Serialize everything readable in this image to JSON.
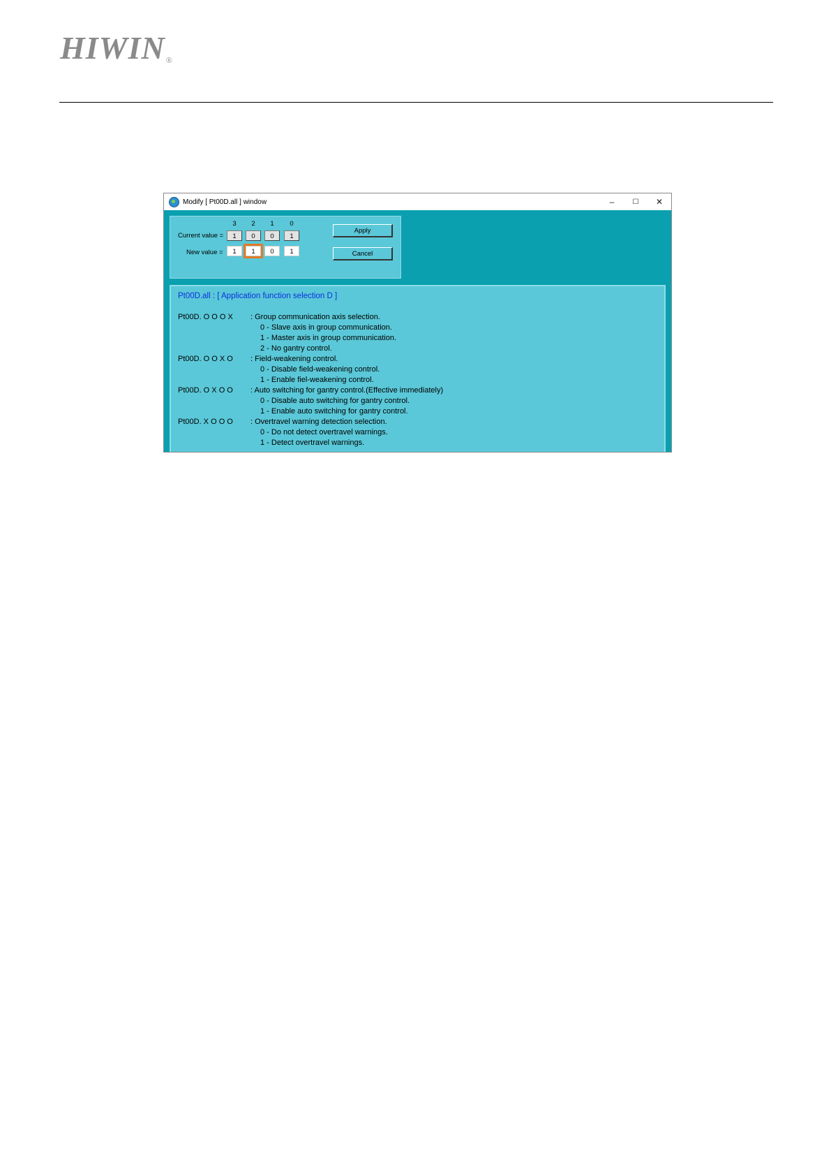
{
  "header": {
    "logo_text": "HIWIN",
    "logo_mark": "®"
  },
  "window": {
    "title": "Modify [ Pt00D.all ] window",
    "controls": {
      "minimize": "–",
      "maximize": "☐",
      "close": "✕"
    },
    "digit_headers": [
      "3",
      "2",
      "1",
      "0"
    ],
    "current_label": "Current value =",
    "current_values": [
      "1",
      "0",
      "0",
      "1"
    ],
    "new_label": "New value =",
    "new_values": [
      "1",
      "1",
      "0",
      "1"
    ],
    "apply_label": "Apply",
    "cancel_label": "Cancel",
    "desc_title": "Pt00D.all :  [ Application function selection D ]",
    "params": [
      {
        "code": "Pt00D.  O  O  O  X",
        "desc": ": Group communication axis selection.",
        "options": [
          "0 - Slave axis in group communication.",
          "1 - Master axis in group communication.",
          "2 - No gantry control."
        ]
      },
      {
        "code": "Pt00D.  O  O  X  O",
        "desc": ": Field-weakening control.",
        "options": [
          "0 - Disable field-weakening control.",
          "1 - Enable fiel-weakening control."
        ]
      },
      {
        "code": "Pt00D.  O  X  O  O",
        "desc": ": Auto switching for gantry control.(Effective immediately)",
        "options": [
          "0 - Disable auto switching for gantry control.",
          "1 - Enable auto switching for gantry control."
        ]
      },
      {
        "code": "Pt00D.  X  O  O  O",
        "desc": ": Overtravel warning detection selection.",
        "options": [
          "0 - Do not detect overtravel warnings.",
          "1 - Detect overtravel warnings."
        ]
      }
    ]
  }
}
